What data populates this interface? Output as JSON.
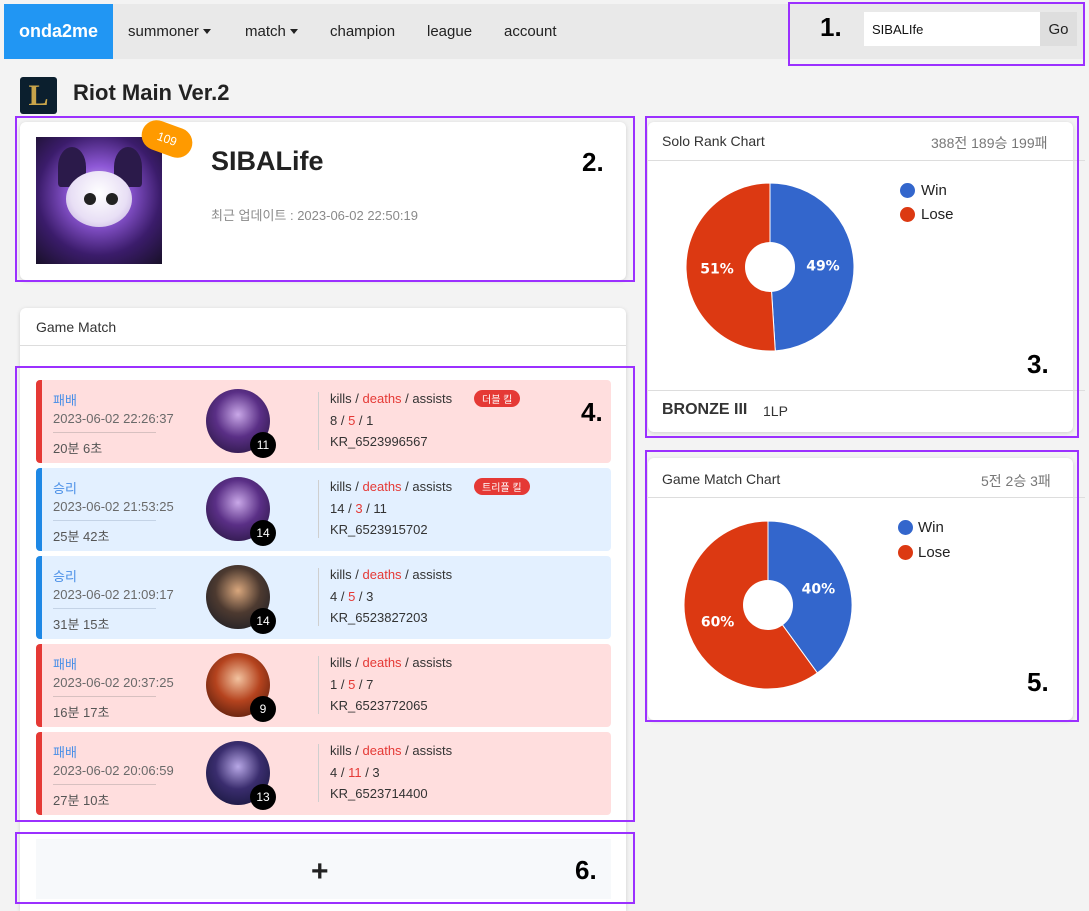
{
  "navbar": {
    "brand": "onda2me",
    "items": [
      {
        "label": "summoner",
        "dropdown": true
      },
      {
        "label": "match",
        "dropdown": true
      },
      {
        "label": "champion",
        "dropdown": false
      },
      {
        "label": "league",
        "dropdown": false
      },
      {
        "label": "account",
        "dropdown": false
      }
    ],
    "search_value": "SIBALIfe",
    "search_button": "Go"
  },
  "annotations": [
    "1.",
    "2.",
    "3.",
    "4.",
    "5.",
    "6."
  ],
  "header": {
    "title": "Riot Main Ver.2",
    "logo_letter": "L"
  },
  "profile": {
    "level": "109",
    "name": "SIBALife",
    "updated": "최근 업데이트 : 2023-06-02 22:50:19"
  },
  "game_match": {
    "title": "Game Match",
    "kda_labels": {
      "kills": "kills",
      "deaths": "deaths",
      "assists": "assists",
      "sep": " / "
    },
    "matches": [
      {
        "result": "패배",
        "outcome": "loss",
        "date": "2023-06-02 22:26:37",
        "duration": "20분 6초",
        "champ_level": "11",
        "kills": "8",
        "deaths": "5",
        "assists": "1",
        "match_id": "KR_6523996567",
        "badge": "더블 킬"
      },
      {
        "result": "승리",
        "outcome": "win",
        "date": "2023-06-02 21:53:25",
        "duration": "25분 42초",
        "champ_level": "14",
        "kills": "14",
        "deaths": "3",
        "assists": "11",
        "match_id": "KR_6523915702",
        "badge": "트리플 킬"
      },
      {
        "result": "승리",
        "outcome": "win",
        "date": "2023-06-02 21:09:17",
        "duration": "31분 15초",
        "champ_level": "14",
        "kills": "4",
        "deaths": "5",
        "assists": "3",
        "match_id": "KR_6523827203",
        "badge": ""
      },
      {
        "result": "패배",
        "outcome": "loss",
        "date": "2023-06-02 20:37:25",
        "duration": "16분 17초",
        "champ_level": "9",
        "kills": "1",
        "deaths": "5",
        "assists": "7",
        "match_id": "KR_6523772065",
        "badge": ""
      },
      {
        "result": "패배",
        "outcome": "loss",
        "date": "2023-06-02 20:06:59",
        "duration": "27분 10초",
        "champ_level": "13",
        "kills": "4",
        "deaths": "11",
        "assists": "3",
        "match_id": "KR_6523714400",
        "badge": ""
      }
    ],
    "more_label": "+"
  },
  "solo_rank": {
    "title": "Solo Rank Chart",
    "summary": "388전 189승 199패",
    "tier": "BRONZE III",
    "lp": "1LP"
  },
  "game_match_chart": {
    "title": "Game Match Chart",
    "summary": "5전 2승 3패"
  },
  "colors": {
    "win": "#3366cc",
    "lose": "#dc3912",
    "accent": "#2196f3",
    "annotation": "#9b30ff"
  },
  "chart_data": [
    {
      "type": "pie",
      "title": "Solo Rank Chart",
      "categories": [
        "Win",
        "Lose"
      ],
      "values": [
        49,
        51
      ],
      "legend": "top-right",
      "donut": true
    },
    {
      "type": "pie",
      "title": "Game Match Chart",
      "categories": [
        "Win",
        "Lose"
      ],
      "values": [
        40,
        60
      ],
      "legend": "top-right",
      "donut": true
    }
  ]
}
